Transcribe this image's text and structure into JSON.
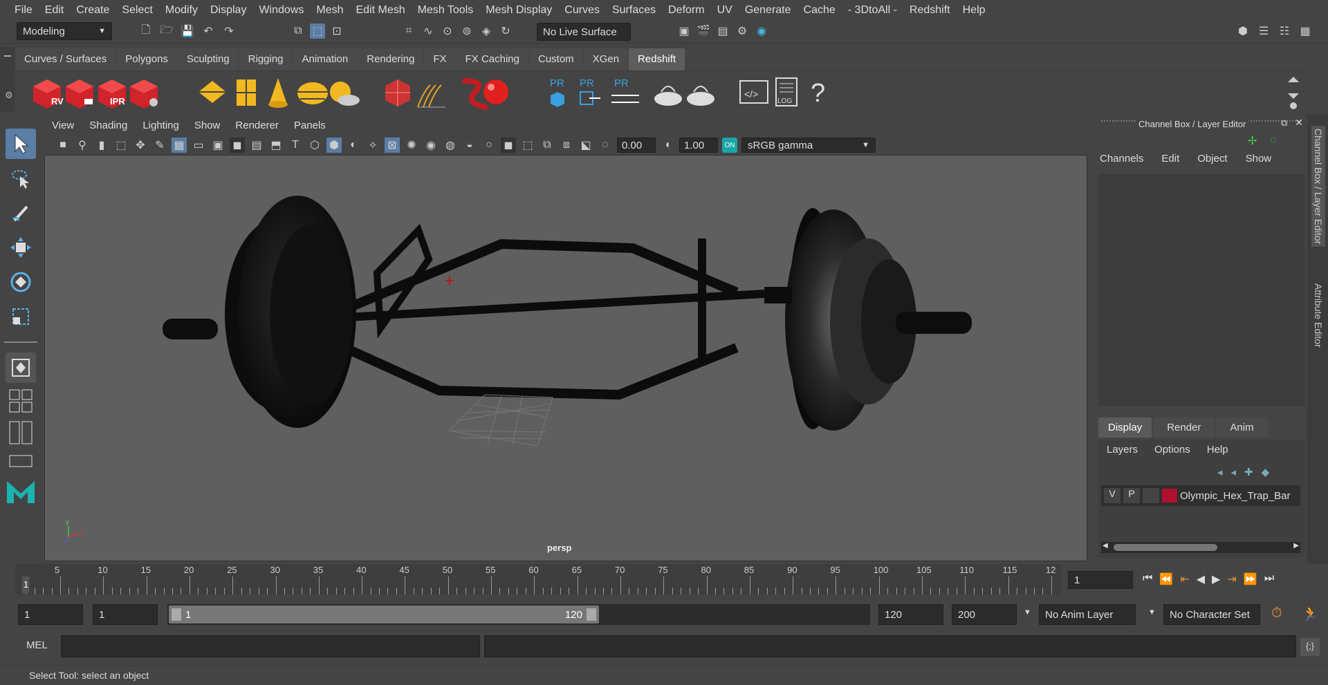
{
  "menus": [
    "File",
    "Edit",
    "Create",
    "Select",
    "Modify",
    "Display",
    "Windows",
    "Mesh",
    "Edit Mesh",
    "Mesh Tools",
    "Mesh Display",
    "Curves",
    "Surfaces",
    "Deform",
    "UV",
    "Generate",
    "Cache",
    "- 3DtoAll -",
    "Redshift",
    "Help"
  ],
  "status": {
    "mode": "Modeling",
    "live_surface": "No Live Surface"
  },
  "shelf": {
    "tabs": [
      "Curves / Surfaces",
      "Polygons",
      "Sculpting",
      "Rigging",
      "Animation",
      "Rendering",
      "FX",
      "FX Caching",
      "Custom",
      "XGen",
      "Redshift"
    ],
    "active_tab": "Redshift",
    "labels": {
      "rv": "RV",
      "ipr": "IPR",
      "pr1": "PR",
      "pr2": "PR",
      "pr3": "PR",
      "log": "LOG",
      "help": "?"
    }
  },
  "viewport": {
    "menus": [
      "View",
      "Shading",
      "Lighting",
      "Show",
      "Renderer",
      "Panels"
    ],
    "exposure": "0.00",
    "gamma": "1.00",
    "color_space": "sRGB gamma",
    "camera_label": "persp",
    "axis_x": "x",
    "axis_y": "y"
  },
  "channel_box": {
    "title": "Channel Box / Layer Editor",
    "menus": [
      "Channels",
      "Edit",
      "Object",
      "Show"
    ]
  },
  "layer_editor": {
    "tabs": [
      "Display",
      "Render",
      "Anim"
    ],
    "active_tab": "Display",
    "menus": [
      "Layers",
      "Options",
      "Help"
    ],
    "layer": {
      "v": "V",
      "p": "P",
      "name": "Olympic_Hex_Trap_Bar",
      "color": "#b01030"
    }
  },
  "side_tabs": [
    "Channel Box / Layer Editor",
    "Attribute Editor"
  ],
  "timeline": {
    "ticks": [
      "5",
      "10",
      "15",
      "20",
      "25",
      "30",
      "35",
      "40",
      "45",
      "50",
      "55",
      "60",
      "65",
      "70",
      "75",
      "80",
      "85",
      "90",
      "95",
      "100",
      "105",
      "110",
      "115",
      "12"
    ],
    "current_frame_marker": "1",
    "current_frame": "1"
  },
  "range": {
    "start": "1",
    "playback_start": "1",
    "slider_start": "1",
    "slider_end": "120",
    "playback_end": "120",
    "end": "200",
    "anim_layer": "No Anim Layer",
    "character_set": "No Character Set"
  },
  "command_line": {
    "language": "MEL"
  },
  "help_line": "Select Tool: select an object"
}
